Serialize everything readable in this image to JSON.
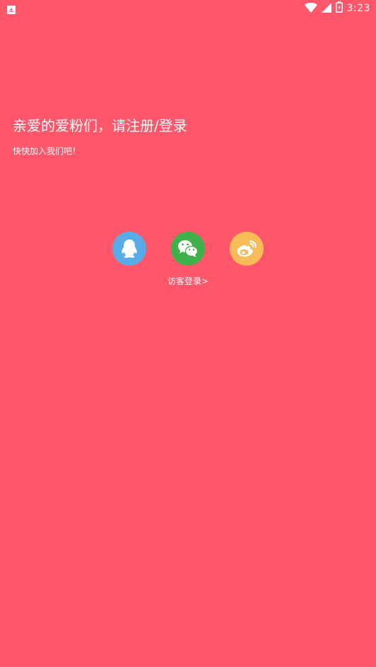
{
  "status_bar": {
    "time": "3:23",
    "left_icon": "notification-a-icon",
    "icons": [
      "wifi-icon",
      "signal-icon",
      "battery-icon"
    ]
  },
  "main": {
    "headline": "亲爱的爱粉们，请注册/登录",
    "subheadline": "快快加入我们吧！",
    "social": [
      {
        "name": "qq",
        "icon": "qq-penguin-icon",
        "color": "#57ACE8"
      },
      {
        "name": "wechat",
        "icon": "wechat-icon",
        "color": "#3FB14A"
      },
      {
        "name": "weibo",
        "icon": "weibo-icon",
        "color": "#F7BB57"
      }
    ],
    "guest_login": "访客登录>"
  },
  "colors": {
    "background": "#FF566A",
    "text": "#FFFFFF"
  }
}
